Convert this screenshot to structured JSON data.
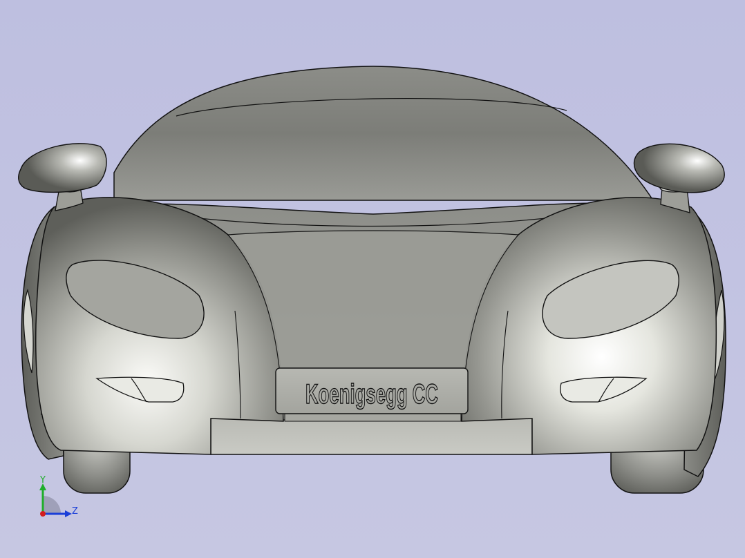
{
  "model": {
    "plate_text": "Koenigsegg CC"
  },
  "triad": {
    "y_label": "Y",
    "z_label": "Z",
    "y_color": "#1fae2a",
    "z_color": "#1b3fd8",
    "x_color": "#d21e1e"
  },
  "colors": {
    "background": "#c3c4e2",
    "body_dark": "#6a6b66",
    "body_mid": "#9c9d97",
    "body_light": "#e8e9e4",
    "edge": "#111111"
  }
}
